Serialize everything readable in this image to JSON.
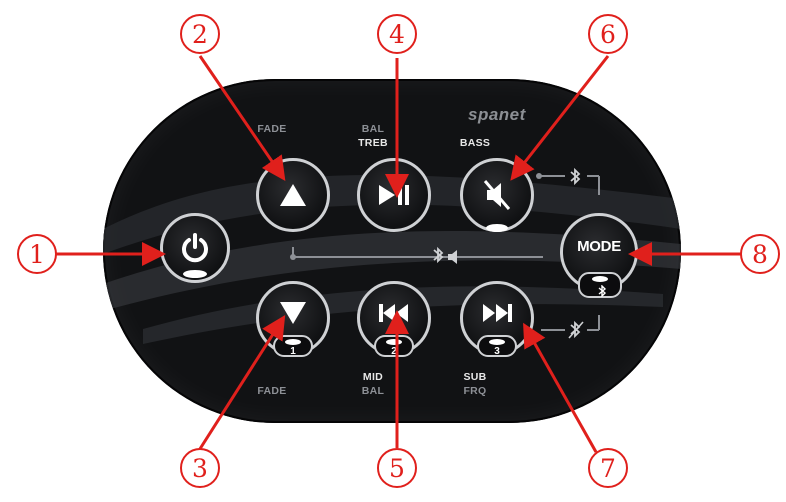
{
  "brand": "spanet",
  "labels": {
    "fade_top": "FADE",
    "bal_top": "BAL",
    "treb": "TREB",
    "bass": "BASS",
    "fade_bottom": "FADE",
    "mid": "MID",
    "bal_bottom": "BAL",
    "sub": "SUB",
    "frq": "FRQ"
  },
  "buttons": {
    "power": {
      "icon": "power-icon"
    },
    "up": {
      "icon": "triangle-up-icon"
    },
    "play_pause": {
      "icon": "play-pause-icon"
    },
    "mute": {
      "icon": "speaker-mute-icon"
    },
    "down": {
      "icon": "triangle-down-icon",
      "number": "1"
    },
    "previous": {
      "icon": "skip-previous-icon",
      "number": "2"
    },
    "next": {
      "icon": "skip-next-icon",
      "number": "3"
    },
    "mode": {
      "label": "MODE",
      "icon": "bluetooth-icon"
    }
  },
  "callouts": [
    "1",
    "2",
    "3",
    "4",
    "5",
    "6",
    "7",
    "8"
  ],
  "colors": {
    "panel": "#111214",
    "callout_red": "#e0201c",
    "button_ring": "#cfd1d4",
    "label_grey": "#8d9096"
  }
}
